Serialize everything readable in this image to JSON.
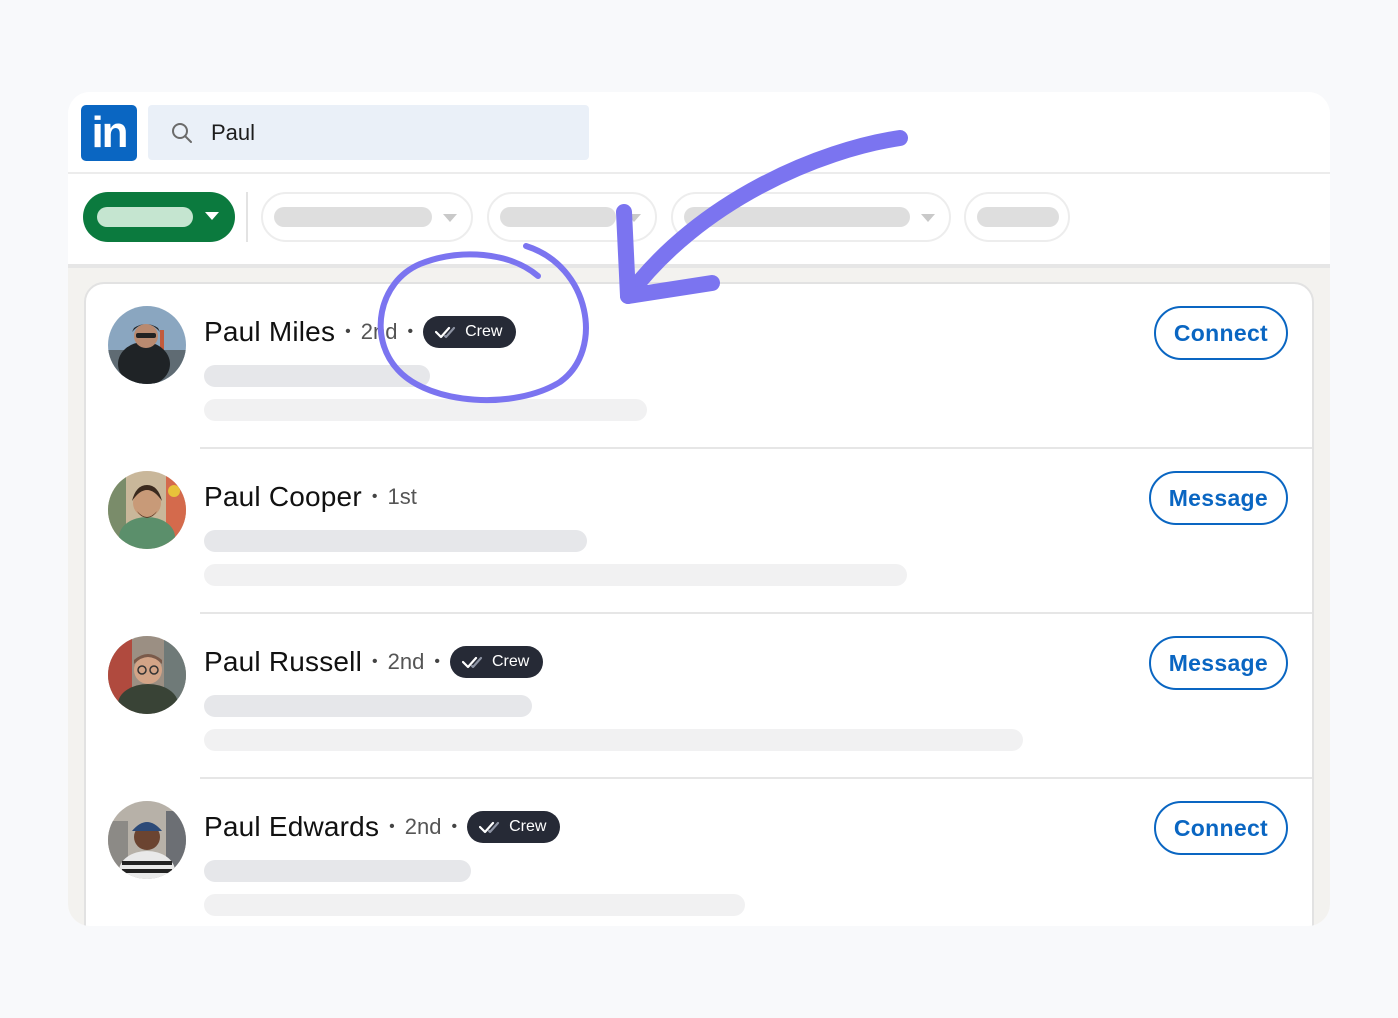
{
  "header": {
    "logo_text": "in",
    "brand_color": "#0a66c2",
    "search_value": "Paul"
  },
  "filters": {
    "active_color": "#0b7a3e"
  },
  "results": [
    {
      "name": "Paul Miles",
      "degree": "2nd",
      "badge": "Crew",
      "action": "Connect"
    },
    {
      "name": "Paul Cooper",
      "degree": "1st",
      "badge": null,
      "action": "Message"
    },
    {
      "name": "Paul Russell",
      "degree": "2nd",
      "badge": "Crew",
      "action": "Message"
    },
    {
      "name": "Paul Edwards",
      "degree": "2nd",
      "badge": "Crew",
      "action": "Connect"
    }
  ],
  "annotation": {
    "color": "#7b74f0",
    "shape": "arrow-with-circle"
  }
}
